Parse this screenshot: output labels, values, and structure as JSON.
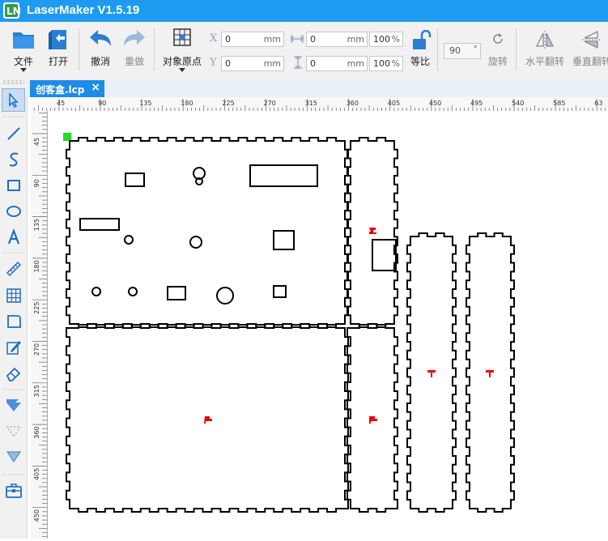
{
  "app": {
    "title": "LaserMaker V1.5.19"
  },
  "toolbar": {
    "file": "文件",
    "open": "打开",
    "undo": "撤消",
    "redo": "重做",
    "origin": "对象原点",
    "x_label": "X",
    "y_label": "Y",
    "x_value": "0",
    "y_value": "0",
    "unit_mm": "mm",
    "width_value": "0",
    "height_value": "0",
    "width_pct": "100",
    "height_pct": "100",
    "pct_unit": "%",
    "lock_ratio": "等比",
    "angle_value": "90",
    "angle_unit": "°",
    "rotate": "旋转",
    "flip_h": "水平翻转",
    "flip_v": "垂直翻转"
  },
  "tabs": [
    {
      "label": "创客盒.lcp",
      "close": "×"
    }
  ],
  "ruler": {
    "top_ticks": [
      "45",
      "90",
      "135",
      "180",
      "225",
      "270",
      "315",
      "360",
      "405",
      "450",
      "495",
      "540",
      "585",
      "63"
    ],
    "left_ticks": [
      "45",
      "90",
      "135",
      "180",
      "225",
      "270",
      "315",
      "360",
      "405",
      "450"
    ]
  },
  "left_tools": [
    "select-arrow-icon",
    "line-icon",
    "curve-icon",
    "rectangle-icon",
    "ellipse-icon",
    "text-icon",
    "ruler-icon",
    "grid-array-icon",
    "rounded-rect-icon",
    "edit-note-icon",
    "eraser-icon",
    "layer-down-icon",
    "layer-dashed-icon",
    "layer-merge-icon",
    "toolbox-icon"
  ],
  "colors": {
    "titlebar": "#1e9bf0",
    "accent": "#1e8ce6",
    "selected_handle": "#22dd22",
    "marker": "#ee0000"
  }
}
